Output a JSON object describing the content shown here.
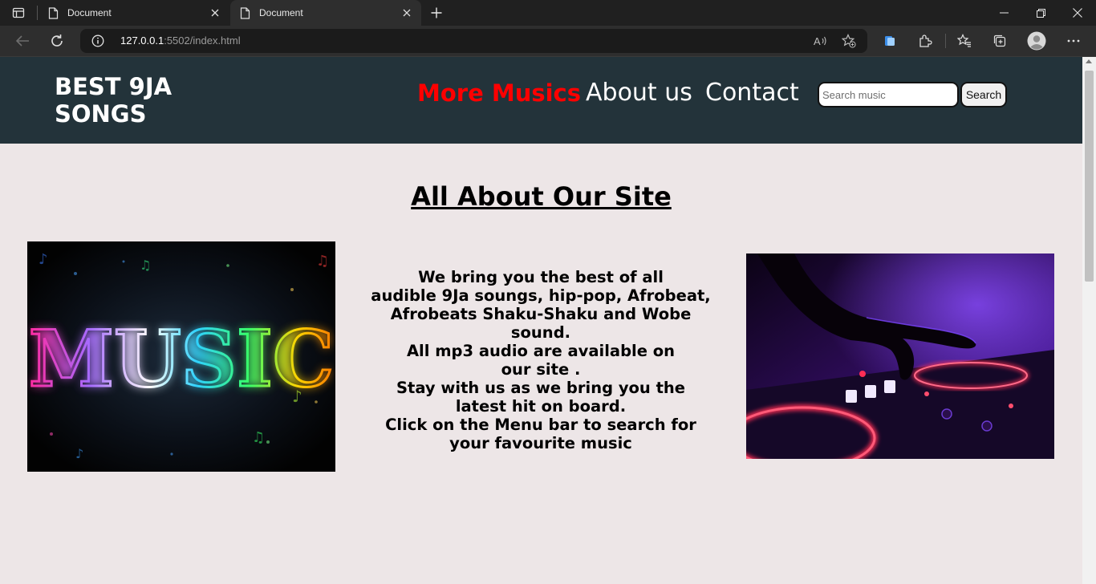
{
  "browser": {
    "tabs": [
      {
        "label": "Document"
      },
      {
        "label": "Document"
      }
    ],
    "url_host": "127.0.0.1",
    "url_rest": ":5502/index.html"
  },
  "site": {
    "logo_line1": "BEST 9JA",
    "logo_line2": "SONGS",
    "nav": {
      "more_musics": "More Musics",
      "about_us": "About us",
      "contact": "Contact"
    },
    "search": {
      "placeholder": "Search music",
      "button": "Search"
    },
    "accent_color": "#ff0000",
    "header_color": "#23333a",
    "background_color": "#ede6e7"
  },
  "main": {
    "title": "All About Our Site",
    "about_lines": [
      "We bring you the best of all",
      "audible 9Ja soungs, hip-pop, Afrobeat,",
      "Afrobeats Shaku-Shaku and Wobe sound.",
      "All mp3 audio are available on",
      "our site .",
      "Stay with us as we bring you the",
      "latest hit on board.",
      "Click on the Menu bar to search for",
      "your favourite music"
    ],
    "left_image_text": "MUSIC"
  }
}
